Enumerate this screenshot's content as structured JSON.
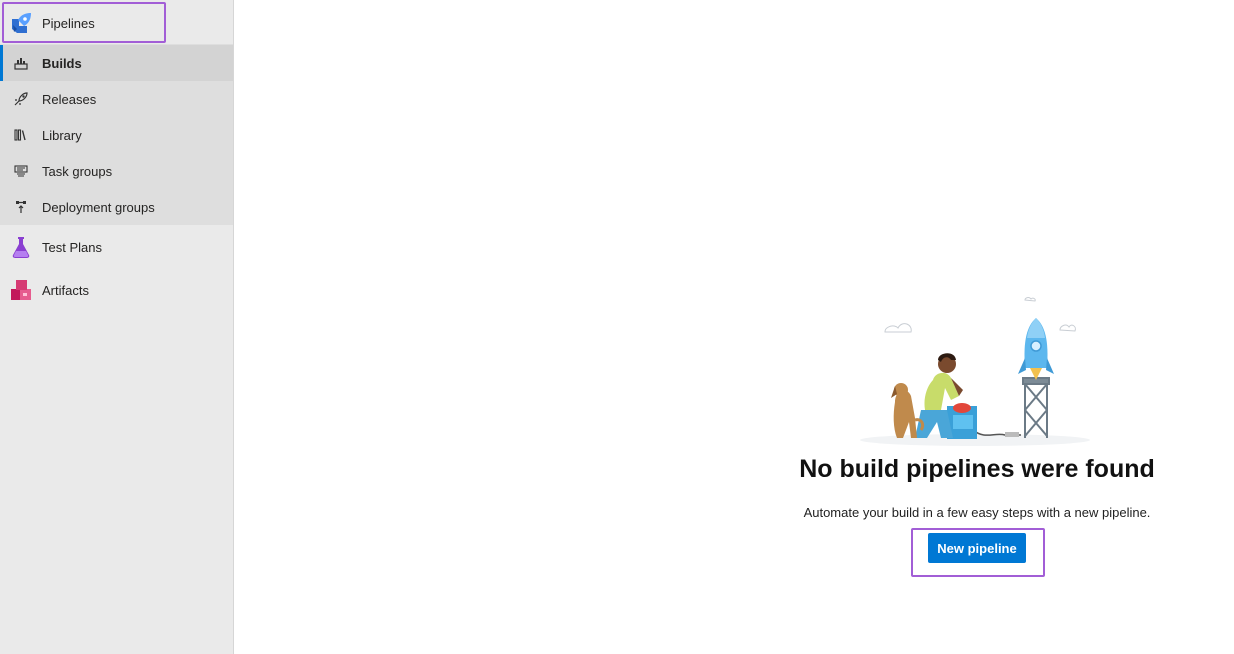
{
  "sidebar": {
    "pipelines_label": "Pipelines",
    "items": [
      {
        "label": "Builds",
        "icon": "builds-icon",
        "selected": true
      },
      {
        "label": "Releases",
        "icon": "rocket-icon"
      },
      {
        "label": "Library",
        "icon": "library-icon"
      },
      {
        "label": "Task groups",
        "icon": "task-groups-icon"
      },
      {
        "label": "Deployment groups",
        "icon": "deployment-groups-icon"
      }
    ],
    "test_plans_label": "Test Plans",
    "artifacts_label": "Artifacts"
  },
  "empty_state": {
    "title": "No build pipelines were found",
    "description": "Automate your build in a few easy steps with a new pipeline.",
    "button_label": "New pipeline"
  },
  "colors": {
    "accent": "#0078d4",
    "highlight": "#a25ed6"
  }
}
